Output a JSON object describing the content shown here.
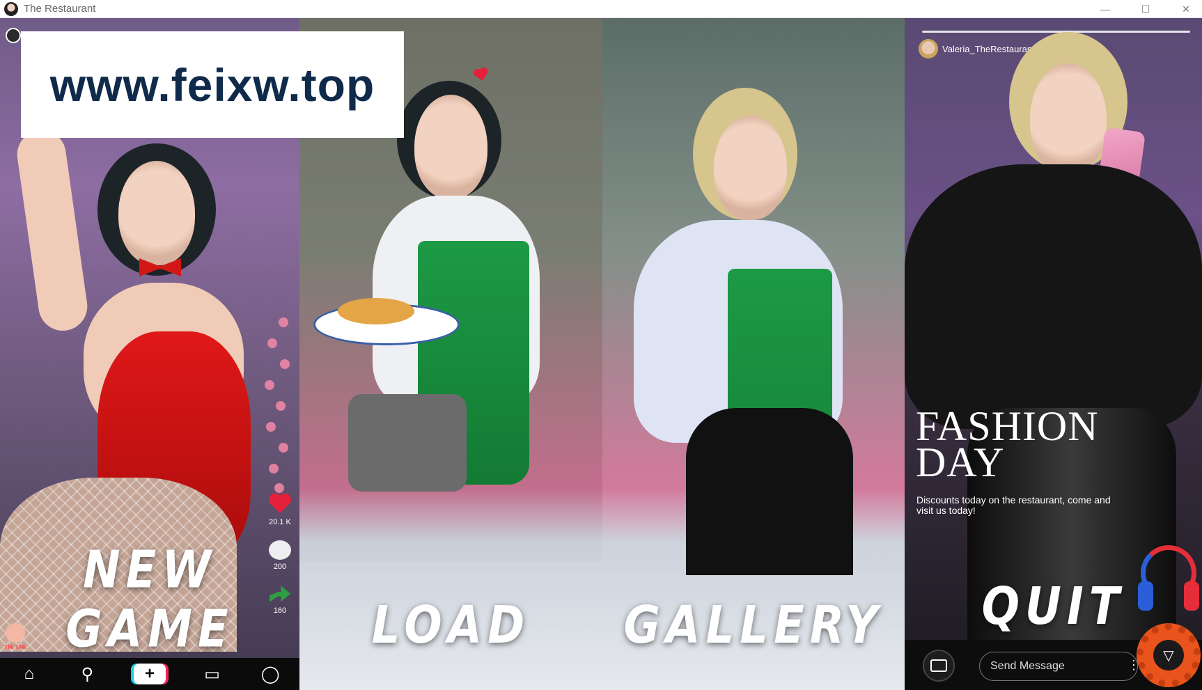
{
  "window": {
    "title": "The Restaurant",
    "minimize_glyph": "—",
    "maximize_glyph": "☐",
    "close_glyph": "✕"
  },
  "watermark": "www.feixw.top",
  "menu": {
    "new_game": "NEW GAME",
    "load": "LOAD",
    "gallery": "GALLERY",
    "quit": "QUIT"
  },
  "social_panel": {
    "likes": "20.1 K",
    "comments": "200",
    "shares": "160",
    "logo_text": "TIK TAK"
  },
  "story_panel": {
    "username": "Valeria_TheRestaurant",
    "headline_line1": "FASHION",
    "headline_line2": "DAY",
    "subtext": "Discounts today on the restaurant, come and visit us today!",
    "message_placeholder": "Send Message"
  },
  "colors": {
    "accent_red": "#e4203a",
    "apron_green": "#1d9a45",
    "gear_orange": "#e8541c"
  },
  "icons": {
    "nav": [
      "home-icon",
      "search-icon",
      "plus-icon",
      "chat-icon",
      "profile-icon"
    ]
  }
}
